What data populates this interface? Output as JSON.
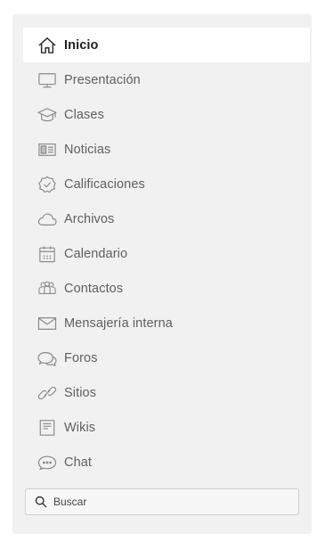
{
  "colors": {
    "panel_bg": "#f1f1f1",
    "active_bg": "#ffffff",
    "text": "#5f5f5f",
    "active_text": "#222222",
    "icon_stroke": "#8a8a8a"
  },
  "nav": {
    "items": [
      {
        "label": "Inicio",
        "icon": "home-icon",
        "active": true
      },
      {
        "label": "Presentación",
        "icon": "monitor-icon",
        "active": false
      },
      {
        "label": "Clases",
        "icon": "graduation-cap-icon",
        "active": false
      },
      {
        "label": "Noticias",
        "icon": "newspaper-icon",
        "active": false
      },
      {
        "label": "Calificaciones",
        "icon": "check-badge-icon",
        "active": false
      },
      {
        "label": "Archivos",
        "icon": "cloud-icon",
        "active": false
      },
      {
        "label": "Calendario",
        "icon": "calendar-icon",
        "active": false
      },
      {
        "label": "Contactos",
        "icon": "people-icon",
        "active": false
      },
      {
        "label": "Mensajería interna",
        "icon": "envelope-icon",
        "active": false
      },
      {
        "label": "Foros",
        "icon": "speech-bubbles-icon",
        "active": false
      },
      {
        "label": "Sitios",
        "icon": "link-icon",
        "active": false
      },
      {
        "label": "Wikis",
        "icon": "wiki-page-icon",
        "active": false
      },
      {
        "label": "Chat",
        "icon": "chat-bubble-icon",
        "active": false
      }
    ]
  },
  "search": {
    "placeholder": "Buscar",
    "icon": "search-icon"
  }
}
